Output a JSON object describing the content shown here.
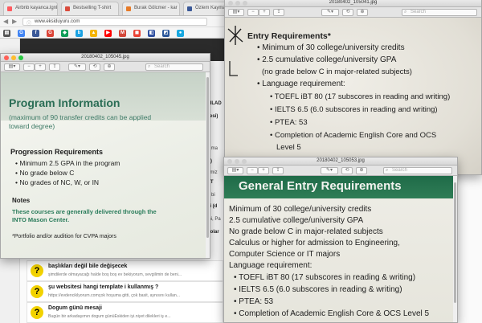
{
  "browser": {
    "tabs": [
      {
        "label": "Airbnb kayanca.lgnl",
        "color": "#ff5a5f"
      },
      {
        "label": "Bestselling T-shirt",
        "color": "#d94b3c"
      },
      {
        "label": "Burak Gölcmer - kar",
        "color": "#e67a28"
      },
      {
        "label": "Özlem Kaymaz",
        "color": "#3b5998"
      }
    ],
    "url": "www.eksiduyuru.com",
    "bookmarks": [
      {
        "letter": "▤",
        "color": "#555"
      },
      {
        "letter": "G",
        "color": "#4285f4"
      },
      {
        "letter": "f",
        "color": "#3b5998"
      },
      {
        "letter": "G",
        "color": "#db4437"
      },
      {
        "letter": "◆",
        "color": "#0f9d58"
      },
      {
        "letter": "b",
        "color": "#1ba1e2"
      },
      {
        "letter": "▲",
        "color": "#f4b400"
      },
      {
        "letter": "▶",
        "color": "#ff0000"
      },
      {
        "letter": "M",
        "color": "#d44638"
      },
      {
        "letter": "◼",
        "color": "#ea4335"
      },
      {
        "letter": "◧",
        "color": "#2f4f9f"
      },
      {
        "letter": "◩",
        "color": "#2b579a"
      },
      {
        "letter": "●",
        "color": "#19a8e0"
      }
    ],
    "side_fragments": [
      "bILAD",
      "zesi)",
      "k ma",
      "ri)",
      "nmiz",
      "AT",
      "n bi",
      "vi (d",
      "ini, Pa",
      "dolar"
    ],
    "posts": [
      {
        "title": "başlıkları değil bile değişecek",
        "snippet": "şimdilerde olmayacağı halde boş boş ev bekiyorum, sevgilimin de beni..."
      },
      {
        "title": "şu websitesi hangi template i kullanmış ?",
        "snippet": "https://evdenciklyorum.comçok hoşuma gitti, çok basit, aynısını kullan..."
      },
      {
        "title": "Dogum günü mesaji",
        "snippet": "Bugün bir arkadaşımın dogum günüEskiden iyi.niyet dilekleri iş e..."
      }
    ]
  },
  "windows": {
    "program": {
      "title": "20180402_105045.jpg",
      "search_placeholder": "Search",
      "heading": "Program Information",
      "sub1": "(maximum of 90 transfer credits can be applied",
      "sub2": "toward degree)",
      "progression_heading": "Progression Requirements",
      "bullets": [
        "Minimum 2.5 GPA in the program",
        "No grade below C",
        "No grades of NC, W, or IN"
      ],
      "notes_heading": "Notes",
      "notes1": "These courses are generally delivered through the",
      "notes2": "INTO Mason Center.",
      "footnote": "*Portfolio and/or audition for CVPA majors"
    },
    "entry": {
      "title": "20180402_105041.jpg",
      "search_placeholder": "Search",
      "heading": "Entry Requirements*",
      "lines": [
        "Minimum of 30 college/university credits",
        "2.5 cumulative college/university GPA",
        "(no grade below C in major-related subjects)",
        "Language requirement:"
      ],
      "bullets": [
        "TOEFL iBT 80 (17 subscores in reading and writing)",
        "IELTS 6.5 (6.0 subscores in reading and writing)",
        "PTEA: 53",
        "Completion of Academic English Core and OCS",
        "Level 5"
      ]
    },
    "general": {
      "title": "20180402_105053.jpg",
      "search_placeholder": "Search",
      "heading": "General Entry Requirements",
      "lines": [
        "Minimum of 30 college/university credits",
        "2.5 cumulative college/university GPA",
        "No grade below C in major-related subjects",
        "Calculus or higher for admission to Engineering,",
        "Computer Science or IT majors",
        "Language requirement:"
      ],
      "bullets": [
        "TOEFL iBT 80 (17 subscores in reading & writing)",
        "IELTS 6.5 (6.0 subscores in reading & writing)",
        "PTEA: 53",
        "Completion of Academic English Core & OCS Level 5"
      ]
    }
  }
}
